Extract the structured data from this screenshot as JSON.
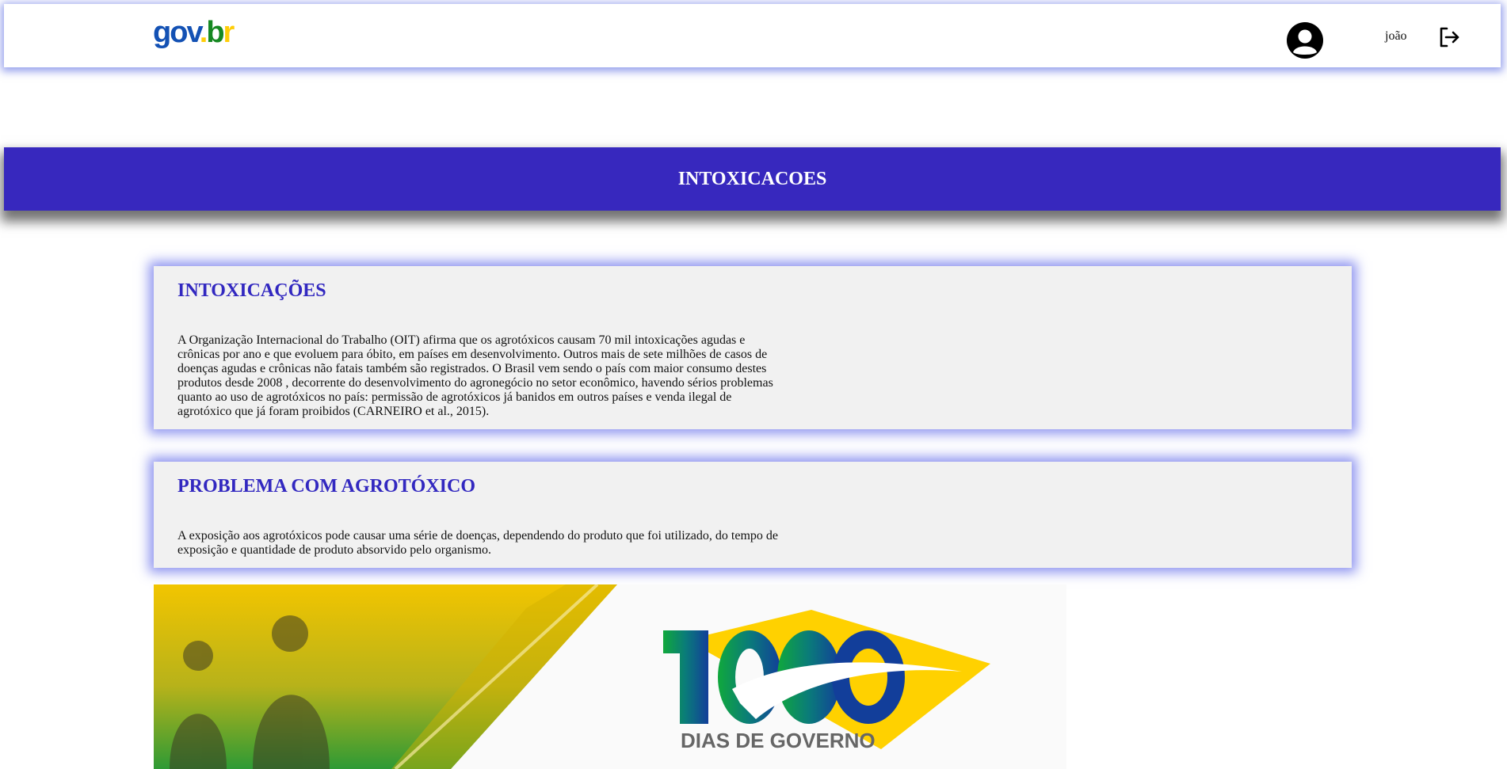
{
  "header": {
    "logo": {
      "g": "g",
      "o": "o",
      "v": "v",
      "dot": ".",
      "b": "b",
      "r": "r"
    },
    "username": "joão",
    "icons": {
      "avatar": "user-circle-icon",
      "logout": "logout-icon"
    }
  },
  "banner": {
    "title": "INTOXICACOES"
  },
  "cards": [
    {
      "title": "INTOXICAÇÕES",
      "text": "A Organização Internacional do Trabalho (OIT) afirma que os agrotóxicos causam 70 mil intoxicações agudas e crônicas por ano e que evoluem para óbito, em países em desenvolvimento. Outros mais de sete milhões de casos de doenças agudas e crônicas não fatais também são registrados. O Brasil vem sendo o país com maior consumo destes produtos desde 2008 , decorrente do desenvolvimento do agronegócio no setor econômico, havendo sérios problemas quanto ao uso de agrotóxicos no país: permissão de agrotóxicos já banidos em outros países e venda ilegal de agrotóxico que já foram proibidos (CARNEIRO et al., 2015)."
    },
    {
      "title": "PROBLEMA COM AGROTÓXICO",
      "text": "A exposição aos agrotóxicos pode causar uma série de doenças, dependendo do produto que foi utilizado, do tempo de exposição e quantidade de produto absorvido pelo organismo."
    }
  ],
  "promo": {
    "caption": "DIAS DE GOVERNO"
  },
  "colors": {
    "brand_blue": "#3728be",
    "title_blue": "#3228c0",
    "card_bg": "#f1f1f1"
  }
}
